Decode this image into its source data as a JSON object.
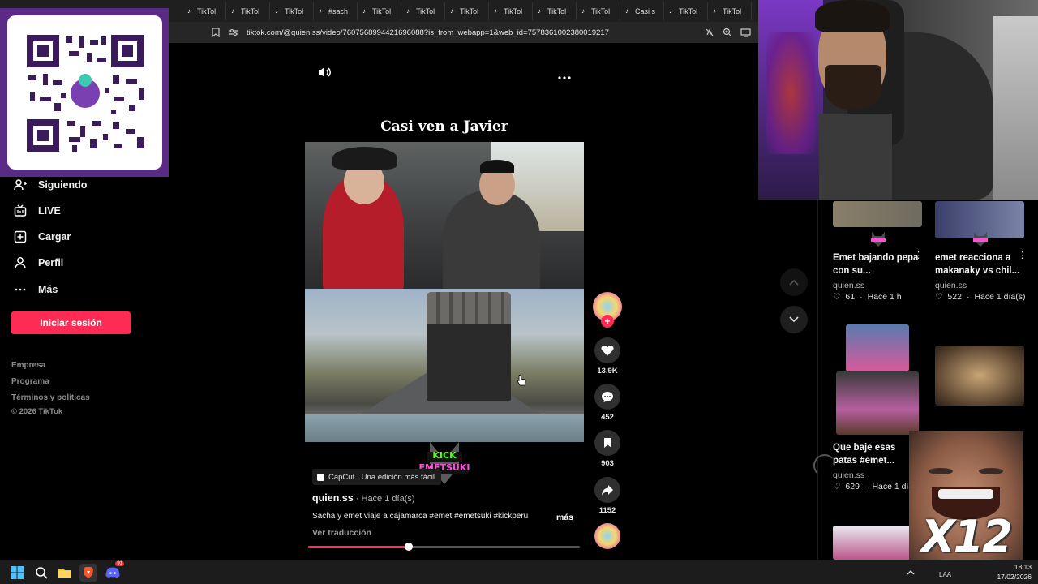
{
  "browser": {
    "tabs": [
      {
        "label": "TikTol"
      },
      {
        "label": "TikTol"
      },
      {
        "label": "TikTol"
      },
      {
        "label": "#sach"
      },
      {
        "label": "TikTol"
      },
      {
        "label": "TikTol"
      },
      {
        "label": "TikTol"
      },
      {
        "label": "TikTol"
      },
      {
        "label": "TikTol"
      },
      {
        "label": "TikTol"
      },
      {
        "label": "Casi s"
      },
      {
        "label": "TikTol"
      },
      {
        "label": "TikTol"
      }
    ],
    "url": "tiktok.com/@quien.ss/video/7607568994421696088?is_from_webapp=1&web_id=7578361002380019217"
  },
  "sidebar": {
    "items": [
      {
        "label": "Siguiendo",
        "icon": "following-icon"
      },
      {
        "label": "LIVE",
        "icon": "live-icon"
      },
      {
        "label": "Cargar",
        "icon": "upload-icon"
      },
      {
        "label": "Perfil",
        "icon": "profile-icon"
      },
      {
        "label": "Más",
        "icon": "more-icon"
      }
    ],
    "login_label": "Iniciar sesión",
    "footer": [
      "Empresa",
      "Programa",
      "Términos y políticas",
      "© 2026 TikTok"
    ]
  },
  "video": {
    "title": "Casi ven a Javier",
    "capcut": "CapCut · Una edición más fácil",
    "author": "quien.ss",
    "ago": " · Hace 1 día(s)",
    "description": "Sacha y emet viaje a cajamarca #emet #emetsuki #kickperu",
    "more_label": "más",
    "translate_label": "Ver traducción",
    "progress": 0.37,
    "watermark_top": "KICK",
    "watermark_bottom": "EMETSUKI"
  },
  "actions": {
    "likes": "13.9K",
    "comments": "452",
    "saves": "903",
    "shares": "1152"
  },
  "recommendations": [
    {
      "title": "Emet bajando pepa con su...",
      "author": "quien.ss",
      "likes": "61",
      "ago": "Hace 1 h"
    },
    {
      "title": "emet reacciona a makanaky vs chil...",
      "author": "quien.ss",
      "likes": "522",
      "ago": "Hace 1 día(s)"
    },
    {
      "title": "Que baje esas patas #emet...",
      "author": "quien.ss",
      "likes": "629",
      "ago": "Hace 1 día"
    }
  ],
  "overlay": {
    "multiplier": "X12"
  },
  "taskbar": {
    "lang": "LAA",
    "time": "18:13",
    "date": "17/02/2026",
    "discord_badge": "91"
  },
  "colors": {
    "accent": "#fe2c55",
    "qr_frame": "#5b2a86"
  }
}
